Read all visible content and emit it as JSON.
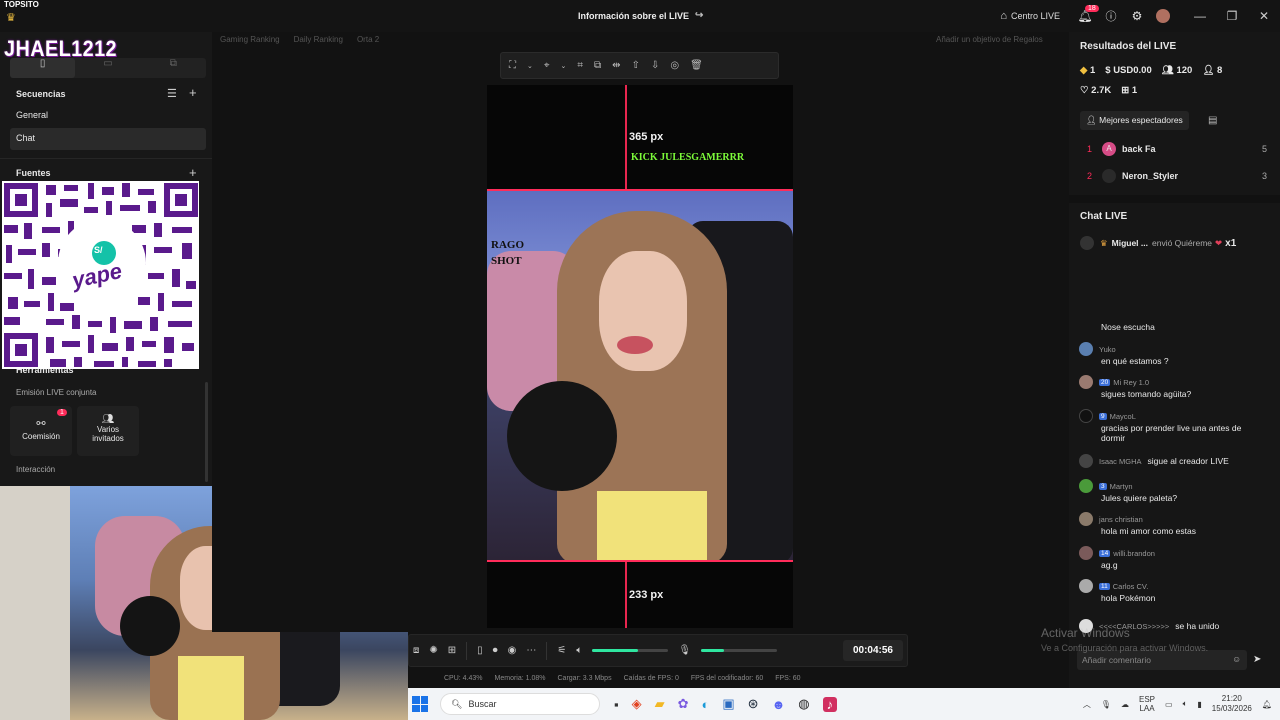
{
  "overlay": {
    "top_label": "TOPSITO",
    "name": "JHAEL1212"
  },
  "titlebar": {
    "title": "Información sobre el LIVE",
    "centro_live": "Centro LIVE",
    "notif_count": "18"
  },
  "left_panel": {
    "sequences_label": "Secuencias",
    "sequences": [
      "General",
      "Chat"
    ],
    "sources_label": "Fuentes",
    "tools_label": "Herramientas",
    "joint_label": "Emisión LIVE conjunta",
    "cohost_label": "Coemisión",
    "cohost_badge": "1",
    "guests_label": "Varios invitados",
    "interaction_label": "Interacción"
  },
  "qr": {
    "brand": "yape",
    "currency": "S/"
  },
  "top_chips": [
    "Gaming Ranking",
    "Daily Ranking",
    "Orta 2"
  ],
  "goal_chip": "Añadir un objetivo de Regalos",
  "preview": {
    "top_px": "365 px",
    "kick_text": "KICK JULESGAMERRR",
    "bottom_px": "233 px",
    "side_text_1": "RAGO",
    "side_text_2": "SHOT"
  },
  "bottom_bar": {
    "timer": "00:04:56",
    "volume_level": 0.6,
    "mic_level": 0.3
  },
  "status_bar": {
    "cpu": "CPU:  4.43%",
    "memory": "Memoria:  1.08%",
    "upload": "Cargar:  3.3 Mbps",
    "fps_drops": "Caídas de FPS:  0",
    "encoder_fps": "FPS del codificador:  60",
    "fps": "FPS:  60"
  },
  "right_panel": {
    "results_title": "Resultados del LIVE",
    "stats": {
      "diamonds": "1",
      "usd": "USD0.00",
      "viewers": "120",
      "followers": "8",
      "likes": "2.7K",
      "gifts": "1"
    },
    "top_viewers_label": "Mejores espectadores",
    "top_viewers": [
      {
        "rank": "1",
        "name": "back Fa",
        "score": "5",
        "initial": "A"
      },
      {
        "rank": "2",
        "name": "Neron_Styler",
        "score": "3",
        "initial": ""
      }
    ],
    "chat_title": "Chat LIVE",
    "gift": {
      "user": "Miguel ...",
      "text": "envió Quiéreme",
      "count": "x1"
    },
    "messages": [
      {
        "user": "",
        "text": "Nose escucha"
      },
      {
        "user": "Yuko",
        "text": "en qué estamos ?"
      },
      {
        "badge": "20",
        "user": "Mi Rey 1.0",
        "text": "sigues tomando agüita?"
      },
      {
        "badge": "9",
        "user": "MaycoL",
        "text": "gracias por prender live una antes de dormir"
      },
      {
        "user": "Isaac MGHA",
        "text": "sigue al creador LIVE"
      },
      {
        "badge": "3",
        "user": "Martyn",
        "text": "Jules quiere paleta?"
      },
      {
        "user": "jans christian",
        "text": "hola mi amor como estas"
      },
      {
        "badge": "14",
        "user": "willi.brandon",
        "text": "ag.g"
      },
      {
        "badge": "11",
        "user": "Carlos CV.",
        "text": "hola Pokémon"
      },
      {
        "user": "<<<<CARLOS>>>>>",
        "text": "se ha unido"
      }
    ],
    "comment_placeholder": "Añadir comentario"
  },
  "watermark": {
    "line1": "Activar Windows",
    "line2": "Ve a Configuración para activar Windows."
  },
  "taskbar": {
    "search": "Buscar",
    "lang1": "ESP",
    "lang2": "LAA",
    "time": "21:20",
    "date": "15/03/2026"
  },
  "colors": {
    "accent": "#ff2c5a",
    "chip_blue": "#3b6fd8",
    "qr_purple": "#5a1a8c"
  }
}
